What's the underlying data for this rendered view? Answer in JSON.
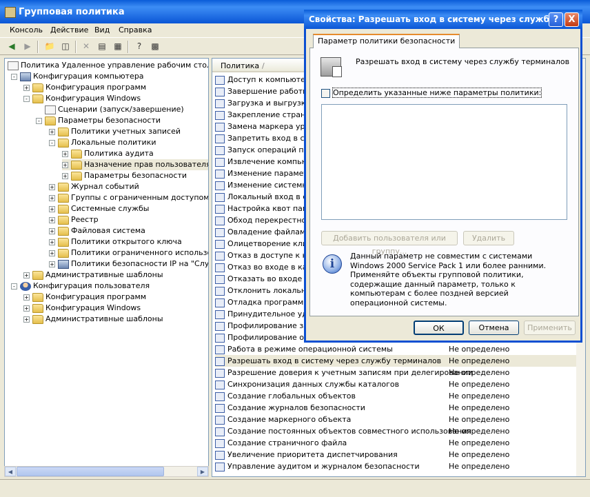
{
  "window": {
    "title": "Групповая политика"
  },
  "menu": [
    "Консоль",
    "Действие",
    "Вид",
    "Справка"
  ],
  "tree": [
    {
      "label": "Политика Удаленное управление рабочим столом [se",
      "indent": 0,
      "icon": "doc",
      "exp": ""
    },
    {
      "label": "Конфигурация компьютера",
      "indent": 1,
      "icon": "comp",
      "exp": "-"
    },
    {
      "label": "Конфигурация программ",
      "indent": 2,
      "icon": "folder",
      "exp": "+"
    },
    {
      "label": "Конфигурация Windows",
      "indent": 2,
      "icon": "folder",
      "exp": "-"
    },
    {
      "label": "Сценарии (запуск/завершение)",
      "indent": 3,
      "icon": "doc",
      "exp": ""
    },
    {
      "label": "Параметры безопасности",
      "indent": 3,
      "icon": "folder",
      "exp": "-"
    },
    {
      "label": "Политики учетных записей",
      "indent": 4,
      "icon": "folder",
      "exp": "+"
    },
    {
      "label": "Локальные политики",
      "indent": 4,
      "icon": "folder",
      "exp": "-"
    },
    {
      "label": "Политика аудита",
      "indent": 5,
      "icon": "folder",
      "exp": "+"
    },
    {
      "label": "Назначение прав пользователя",
      "indent": 5,
      "icon": "folder",
      "exp": "+",
      "selected": true
    },
    {
      "label": "Параметры безопасности",
      "indent": 5,
      "icon": "folder",
      "exp": "+"
    },
    {
      "label": "Журнал событий",
      "indent": 4,
      "icon": "folder",
      "exp": "+"
    },
    {
      "label": "Группы с ограниченным доступом",
      "indent": 4,
      "icon": "folder",
      "exp": "+"
    },
    {
      "label": "Системные службы",
      "indent": 4,
      "icon": "folder",
      "exp": "+"
    },
    {
      "label": "Реестр",
      "indent": 4,
      "icon": "folder",
      "exp": "+"
    },
    {
      "label": "Файловая система",
      "indent": 4,
      "icon": "folder",
      "exp": "+"
    },
    {
      "label": "Политики открытого ключа",
      "indent": 4,
      "icon": "folder",
      "exp": "+"
    },
    {
      "label": "Политики ограниченного использован",
      "indent": 4,
      "icon": "folder",
      "exp": "+"
    },
    {
      "label": "Политики безопасности IP на \"Служба",
      "indent": 4,
      "icon": "comp",
      "exp": "+"
    },
    {
      "label": "Административные шаблоны",
      "indent": 2,
      "icon": "folder",
      "exp": "+"
    },
    {
      "label": "Конфигурация пользователя",
      "indent": 1,
      "icon": "user",
      "exp": "-"
    },
    {
      "label": "Конфигурация программ",
      "indent": 2,
      "icon": "folder",
      "exp": "+"
    },
    {
      "label": "Конфигурация Windows",
      "indent": 2,
      "icon": "folder",
      "exp": "+"
    },
    {
      "label": "Административные шаблоны",
      "indent": 2,
      "icon": "folder",
      "exp": "+"
    }
  ],
  "list": {
    "col_policy": "Политика",
    "sort_mark": "/",
    "rows": [
      {
        "policy": "Доступ к компьютеру",
        "value": ""
      },
      {
        "policy": "Завершение работы с",
        "value": ""
      },
      {
        "policy": "Загрузка и выгрузка д",
        "value": ""
      },
      {
        "policy": "Закрепление страниц",
        "value": ""
      },
      {
        "policy": "Замена маркера уровн",
        "value": ""
      },
      {
        "policy": "Запретить вход в систе",
        "value": ""
      },
      {
        "policy": "Запуск операций по о",
        "value": ""
      },
      {
        "policy": "Извлечение компьюте",
        "value": ""
      },
      {
        "policy": "Изменение параметро",
        "value": ""
      },
      {
        "policy": "Изменение системного",
        "value": ""
      },
      {
        "policy": "Локальный вход в сист",
        "value": ""
      },
      {
        "policy": "Настройка квот памят",
        "value": ""
      },
      {
        "policy": "Обход перекрестной п",
        "value": ""
      },
      {
        "policy": "Овладение файлами и",
        "value": ""
      },
      {
        "policy": "Олицетворение клиен",
        "value": ""
      },
      {
        "policy": "Отказ в доступе к ком",
        "value": ""
      },
      {
        "policy": "Отказ во входе в каче",
        "value": ""
      },
      {
        "policy": "Отказать во входе в с",
        "value": ""
      },
      {
        "policy": "Отклонить локальны",
        "value": ""
      },
      {
        "policy": "Отладка программ",
        "value": ""
      },
      {
        "policy": "Принудительное удал",
        "value": ""
      },
      {
        "policy": "Профилирование загр",
        "value": ""
      },
      {
        "policy": "Профилирование одно",
        "value": ""
      },
      {
        "policy": "Работа в режиме операционной системы",
        "value": "Не определено"
      },
      {
        "policy": "Разрешать вход в систему через службу терминалов",
        "value": "Не определено",
        "selected": true
      },
      {
        "policy": "Разрешение доверия к учетным записям при делегировании",
        "value": "Не определено"
      },
      {
        "policy": "Синхронизация данных службы каталогов",
        "value": "Не определено"
      },
      {
        "policy": "Создание глобальных объектов",
        "value": "Не определено"
      },
      {
        "policy": "Создание журналов безопасности",
        "value": "Не определено"
      },
      {
        "policy": "Создание маркерного объекта",
        "value": "Не определено"
      },
      {
        "policy": "Создание постоянных объектов совместного использования",
        "value": "Не определено"
      },
      {
        "policy": "Создание страничного файла",
        "value": "Не определено"
      },
      {
        "policy": "Увеличение приоритета диспетчирования",
        "value": "Не определено"
      },
      {
        "policy": "Управление аудитом и журналом безопасности",
        "value": "Не определено"
      }
    ]
  },
  "dialog": {
    "title": "Свойства: Разрешать вход в систему через службу ...",
    "help": "?",
    "close": "X",
    "tab": "Параметр политики безопасности",
    "heading": "Разрешать вход в систему через службу терминалов",
    "checkbox_label": "Определить указанные ниже параметры политики:",
    "add_button": "Добавить пользователя или группу...",
    "remove_button": "Удалить",
    "info_icon": "i",
    "info_text": "Данный параметр не совместим с системами Windows 2000 Service Pack 1 или более ранними. Применяйте объекты групповой политики, содержащие данный параметр, только к компьютерам с более поздней версией операционной системы.",
    "ok": "ОК",
    "cancel": "Отмена",
    "apply": "Применить"
  }
}
